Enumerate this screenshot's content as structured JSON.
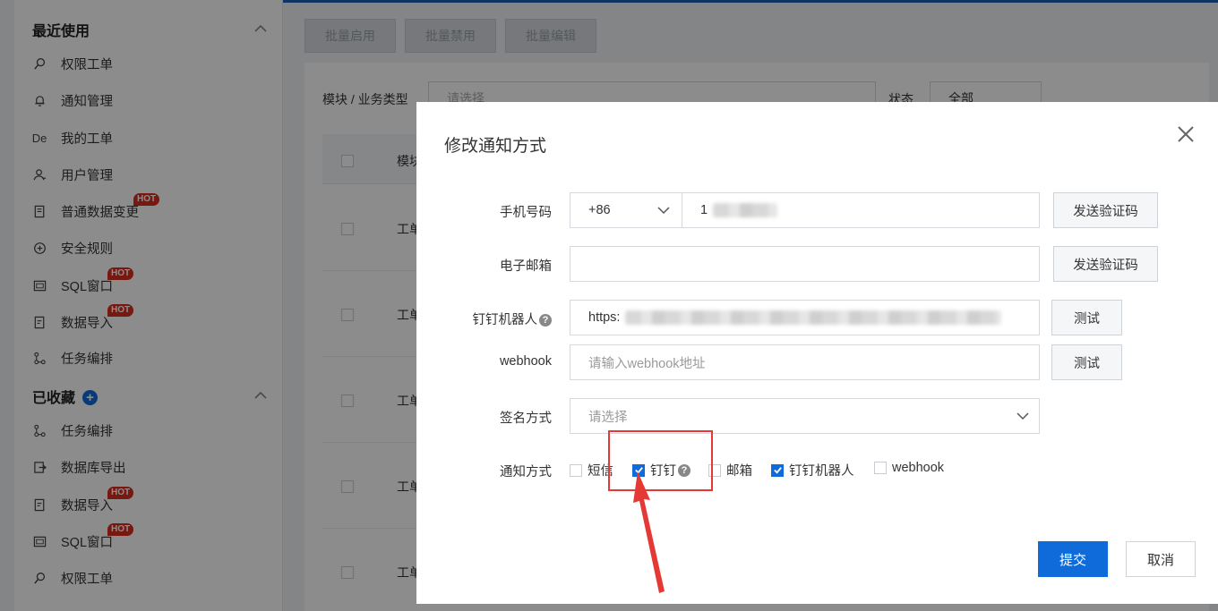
{
  "sidebar": {
    "recent": {
      "title": "最近使用",
      "items": [
        {
          "label": "权限工单",
          "icon": "search-icon",
          "hot": ""
        },
        {
          "label": "通知管理",
          "icon": "bell-icon",
          "hot": ""
        },
        {
          "label": "我的工单",
          "icon": "de-icon",
          "hot": ""
        },
        {
          "label": "用户管理",
          "icon": "user-icon",
          "hot": ""
        },
        {
          "label": "普通数据变更",
          "icon": "document-icon",
          "hot": "HOT"
        },
        {
          "label": "安全规则",
          "icon": "shield-plus-icon",
          "hot": ""
        },
        {
          "label": "SQL窗口",
          "icon": "sql-window-icon",
          "hot": "HOT"
        },
        {
          "label": "数据导入",
          "icon": "import-icon",
          "hot": "HOT"
        },
        {
          "label": "任务编排",
          "icon": "flow-icon",
          "hot": ""
        }
      ]
    },
    "favorites": {
      "title": "已收藏",
      "items": [
        {
          "label": "任务编排",
          "icon": "flow-icon",
          "hot": ""
        },
        {
          "label": "数据库导出",
          "icon": "export-icon",
          "hot": ""
        },
        {
          "label": "数据导入",
          "icon": "import-icon",
          "hot": "HOT"
        },
        {
          "label": "SQL窗口",
          "icon": "sql-window-icon",
          "hot": "HOT"
        },
        {
          "label": "权限工单",
          "icon": "search-icon",
          "hot": ""
        }
      ]
    }
  },
  "toolbar": {
    "batch_enable": "批量启用",
    "batch_disable": "批量禁用",
    "batch_edit": "批量编辑"
  },
  "filters": {
    "module_label": "模块 / 业务类型",
    "module_placeholder": "请选择",
    "status_label": "状态",
    "status_value": "全部"
  },
  "table": {
    "header_col": "模块",
    "rows": [
      "工单",
      "工单",
      "工单",
      "工单",
      "工单"
    ]
  },
  "modal": {
    "title": "修改通知方式",
    "phone": {
      "label": "手机号码",
      "country_code": "+86",
      "value": "1",
      "button": "发送验证码"
    },
    "email": {
      "label": "电子邮箱",
      "value": "",
      "button": "发送验证码"
    },
    "dingtalk_robot": {
      "label": "钉钉机器人",
      "value": "https:",
      "button": "测试"
    },
    "webhook": {
      "label": "webhook",
      "placeholder": "请输入webhook地址",
      "button": "测试"
    },
    "sign_method": {
      "label": "签名方式",
      "placeholder": "请选择"
    },
    "notify_methods": {
      "label": "通知方式",
      "options": [
        {
          "label": "短信",
          "checked": false
        },
        {
          "label": "钉钉",
          "checked": true
        },
        {
          "label": "邮箱",
          "checked": false
        },
        {
          "label": "钉钉机器人",
          "checked": true
        },
        {
          "label": "webhook",
          "checked": false
        }
      ]
    },
    "submit": "提交",
    "cancel": "取消"
  },
  "colors": {
    "primary": "#0f6bd9",
    "hot_badge": "#d92d20",
    "annotation": "#e53935"
  }
}
